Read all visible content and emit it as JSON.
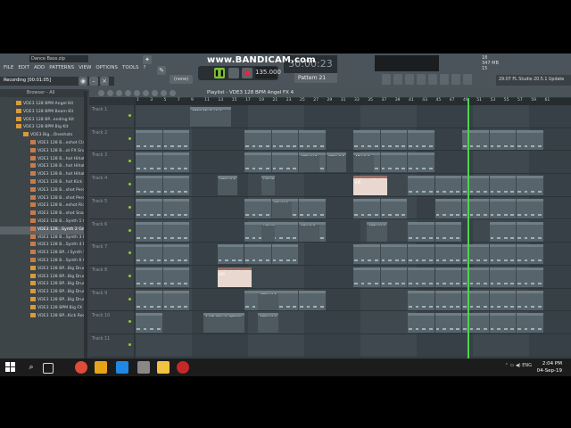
{
  "window": {
    "file_title": "Dance Bass.zip",
    "recording": "Recording [00:01:05]"
  },
  "menu": [
    "FILE",
    "EDIT",
    "ADD",
    "PATTERNS",
    "VIEW",
    "OPTIONS",
    "TOOLS",
    "?"
  ],
  "watermark": {
    "text": "www.BANDICAM.com"
  },
  "transport": {
    "tempo": "135.000",
    "song_position": "30:00:23",
    "pattern": "Pattern 21",
    "pat_mode": "(none)"
  },
  "status": {
    "cpu": "18",
    "ram": "347 MB",
    "poly": "15"
  },
  "news": "29:07 FL Studio 20.5.1 Update",
  "browser": {
    "title": "Browser - All",
    "items": [
      "VDE3 128 BPM Angel Kit",
      "VDE3 128 BPM Beam Kit",
      "VDE3 128 BP...ending Kit",
      "VDE3 128 BPM Big Kit",
      "VDE3 Big...Oneshots",
      "VDE3 128 B...eshot Clap",
      "VDE3 128 B...ot FX Snare",
      "VDE3 128 B...hot Hihat 1",
      "VDE3 128 B...hot Hihat 2",
      "VDE3 128 B...hot Hihat 3",
      "VDE3 128 B...hot Kick G",
      "VDE3 128 B...shot Perc 1",
      "VDE3 128 B...shot Perc 2",
      "VDE3 128 B...eshot Ride",
      "VDE3 128 B...shot Snare",
      "VDE3 128 B...Synth 1 G",
      "VDE3 128...Synth 2 Gm",
      "VDE3 128 B...Synth 3 Dm",
      "VDE3 128 B...Synth 4 D#",
      "VDE3 128 BP...l Synth 5 F",
      "VDE3 128 B...Synth 6 Gm",
      "VDE3 128 BP...Big Drums 1",
      "VDE3 128 BP...Big Drums 2",
      "VDE3 128 BP...Big Drums 3",
      "VDE3 128 BP...Big Drums 4",
      "VDE3 128 BP...Big Drums 5",
      "VDE3 128 BPM Big FX",
      "VDE3 128 BP...Kick Root G"
    ]
  },
  "playlist": {
    "title": "Playlist - VDE3 128 BPM Angel FX 4",
    "bars": [
      "1",
      "3",
      "5",
      "7",
      "9",
      "11",
      "13",
      "15",
      "17",
      "19",
      "21",
      "23",
      "25",
      "27",
      "29",
      "31",
      "33",
      "35",
      "37",
      "39",
      "41",
      "43",
      "45",
      "47",
      "49",
      "51",
      "53",
      "55",
      "57",
      "59",
      "61"
    ],
    "tracks": [
      "Track 1",
      "Track 2",
      "Track 3",
      "Track 4",
      "Track 5",
      "Track 6",
      "Track 7",
      "Track 8",
      "Track 9",
      "Track 10",
      "Track 11"
    ],
    "clips": [
      {
        "track": 0,
        "label": "VDE3 12..el FX 1",
        "start": 17,
        "len": 6,
        "kind": "dark"
      },
      {
        "track": 4,
        "label": "VD...X 4",
        "start": 41,
        "len": 3,
        "kind": "dark"
      },
      {
        "track": 2,
        "label": "VDE...X 2",
        "start": 49,
        "len": 3,
        "kind": "dark"
      },
      {
        "track": 2,
        "label": "VDE...X 2",
        "start": 57,
        "len": 3,
        "kind": "dark"
      },
      {
        "track": 2,
        "label": "VD...X 4",
        "start": 65,
        "len": 3,
        "kind": "dark"
      },
      {
        "track": 3,
        "label": "VDE...X 2",
        "start": 25,
        "len": 3,
        "kind": "dark"
      },
      {
        "track": 3,
        "label": "Pat...27",
        "start": 38,
        "len": 2,
        "kind": "dark"
      },
      {
        "track": 3,
        "label": "VAD...0 KIR",
        "start": 65,
        "len": 3,
        "kind": "wave"
      },
      {
        "track": 3,
        "label": "VAD...318",
        "start": 69,
        "len": 3,
        "kind": "wave"
      },
      {
        "track": 5,
        "label": "Pat...36",
        "start": 38,
        "len": 2,
        "kind": "dark"
      },
      {
        "track": 5,
        "label": "VD...X 4",
        "start": 49,
        "len": 3,
        "kind": "dark"
      },
      {
        "track": 5,
        "label": "VDE...X 1",
        "start": 69,
        "len": 3,
        "kind": "dark"
      },
      {
        "track": 7,
        "label": "VAD...p KIR",
        "start": 25,
        "len": 3,
        "kind": "wave"
      },
      {
        "track": 7,
        "label": "VAD...318",
        "start": 29,
        "len": 3,
        "kind": "wave"
      },
      {
        "track": 8,
        "label": "VDE...X 2",
        "start": 37,
        "len": 3,
        "kind": "dark"
      },
      {
        "track": 9,
        "label": "VTS2 Ide...M Uplifter",
        "start": 21,
        "len": 6,
        "kind": "dark"
      },
      {
        "track": 9,
        "label": "VDE...X 3",
        "start": 37,
        "len": 3,
        "kind": "dark"
      }
    ]
  },
  "taskbar": {
    "time": "2:04 PM",
    "date": "04-Sep-19",
    "lang": "ENG"
  }
}
